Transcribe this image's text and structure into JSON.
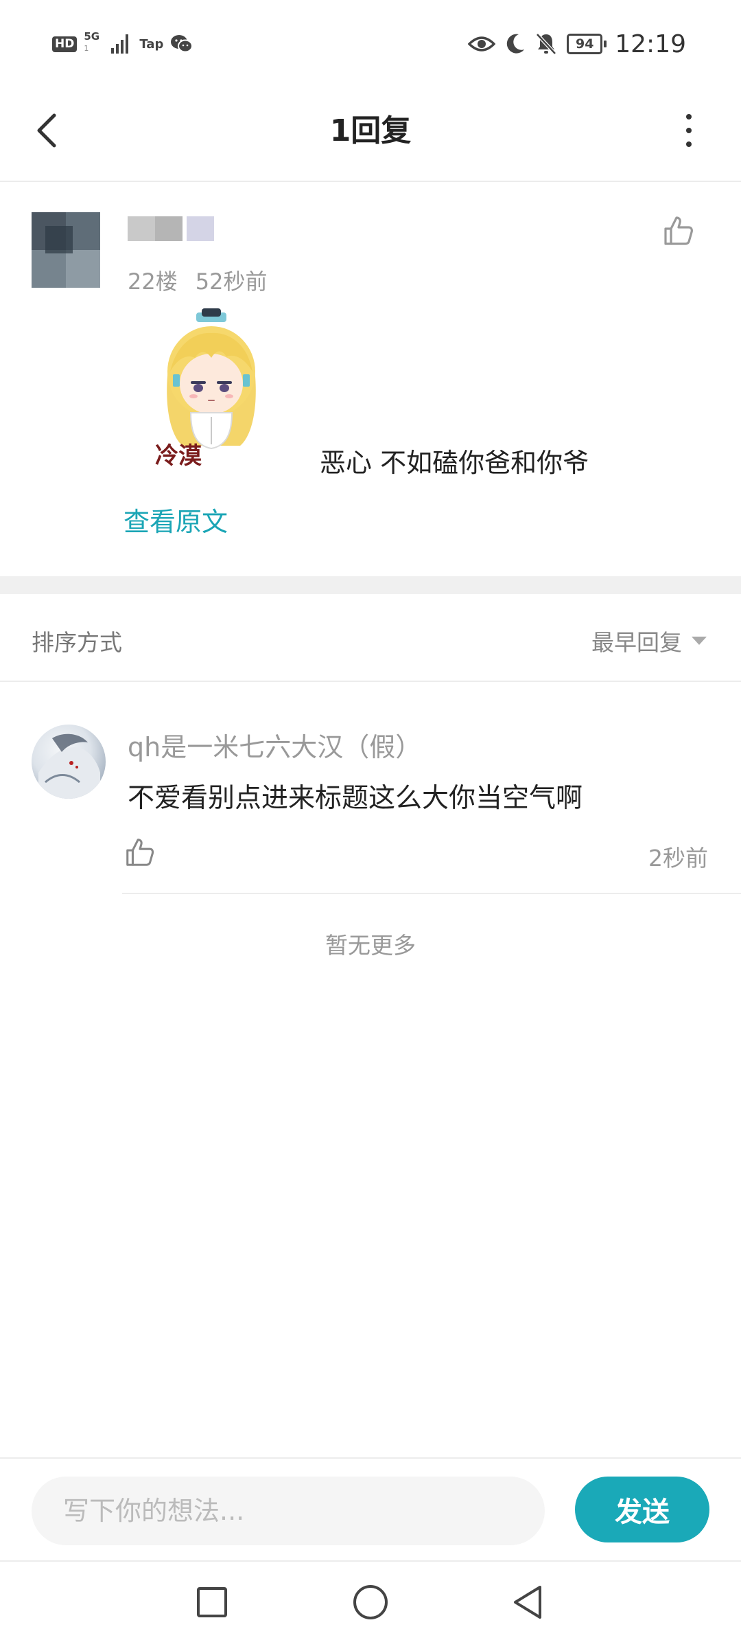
{
  "status_bar": {
    "hd": "HD",
    "network": "5G",
    "network_sub": "1",
    "app": "Tap",
    "battery": "94",
    "time": "12:19"
  },
  "header": {
    "title": "1回复"
  },
  "post": {
    "floor": "22楼",
    "time": "52秒前",
    "text": "恶心 不如磕你爸和你爷",
    "sticker_text": "冷漠",
    "view_original": "查看原文"
  },
  "sort": {
    "label": "排序方式",
    "value": "最早回复"
  },
  "reply": {
    "username": "qh是一米七六大汉（假）",
    "text": "不爱看别点进来标题这么大你当空气啊",
    "time": "2秒前"
  },
  "footer": {
    "no_more": "暂无更多"
  },
  "input": {
    "placeholder": "写下你的想法...",
    "send_label": "发送"
  },
  "colors": {
    "accent": "#1aa9b8",
    "link": "#1aa5b5"
  }
}
